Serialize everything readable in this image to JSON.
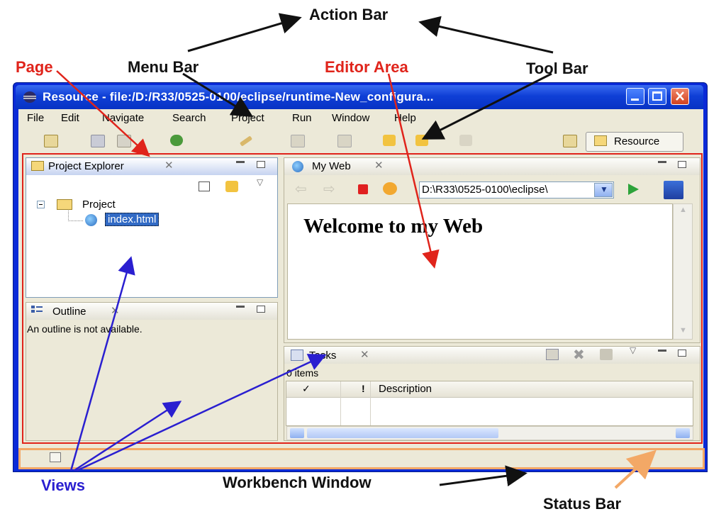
{
  "callouts": {
    "action_bar": "Action Bar",
    "menu_bar": "Menu Bar",
    "page": "Page",
    "editor_area": "Editor Area",
    "tool_bar": "Tool Bar",
    "views": "Views",
    "workbench_window": "Workbench Window",
    "status_bar": "Status Bar"
  },
  "window": {
    "title": "Resource - file:/D:/R33/0525-0100/eclipse/runtime-New_configura..."
  },
  "menu": [
    "File",
    "Edit",
    "Navigate",
    "Search",
    "Project",
    "Run",
    "Window",
    "Help"
  ],
  "toolbar": {
    "perspective_label": "Resource"
  },
  "project_explorer": {
    "tab": "Project Explorer",
    "project": "Project",
    "file": "index.html"
  },
  "outline": {
    "tab": "Outline",
    "message": "An outline is not available."
  },
  "editor": {
    "tab": "My Web",
    "url": "D:\\R33\\0525-0100\\eclipse\\",
    "heading": "Welcome to my Web"
  },
  "tasks": {
    "tab": "Tasks",
    "count": "0 items",
    "col_check": "✓",
    "col_priority": "!",
    "col_description": "Description"
  },
  "colors": {
    "callout_red": "#e0241b",
    "callout_blue": "#2a1fd0",
    "titlebar_blue": "#0f3fd6",
    "status_orange": "#f3a866"
  }
}
